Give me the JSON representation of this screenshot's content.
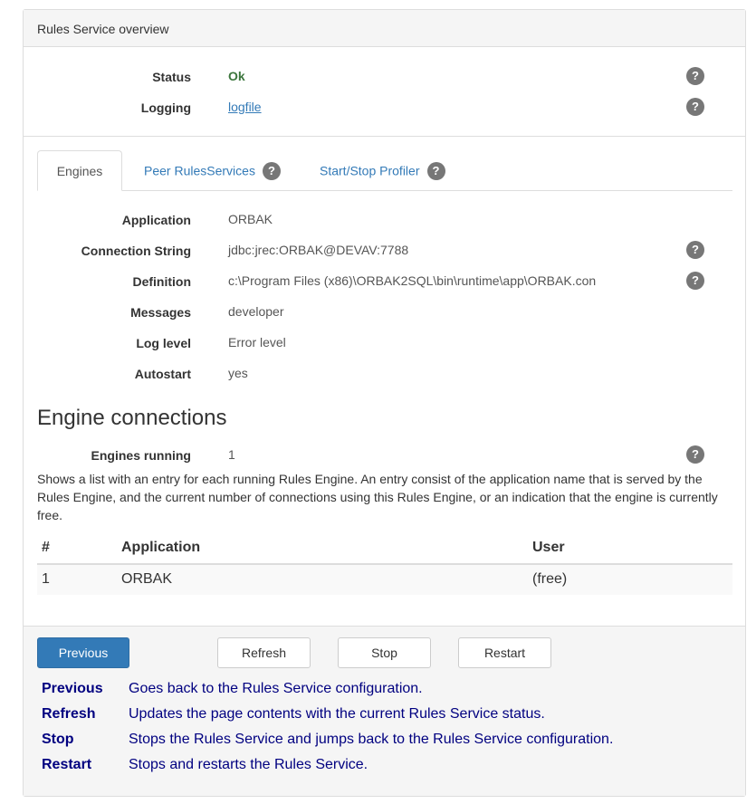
{
  "panel": {
    "title": "Rules Service overview"
  },
  "overview": {
    "status_label": "Status",
    "status_value": "Ok",
    "logging_label": "Logging",
    "logging_value": "logfile"
  },
  "help_icon_text": "?",
  "tabs": [
    {
      "label": "Engines",
      "active": true
    },
    {
      "label": "Peer RulesServices",
      "active": false
    },
    {
      "label": "Start/Stop Profiler",
      "active": false
    }
  ],
  "engine": {
    "application_label": "Application",
    "application_value": "ORBAK",
    "connection_label": "Connection String",
    "connection_value": "jdbc:jrec:ORBAK@DEVAV:7788",
    "definition_label": "Definition",
    "definition_value": "c:\\Program Files (x86)\\ORBAK2SQL\\bin\\runtime\\app\\ORBAK.con",
    "messages_label": "Messages",
    "messages_value": "developer",
    "loglevel_label": "Log level",
    "loglevel_value": "Error level",
    "autostart_label": "Autostart",
    "autostart_value": "yes"
  },
  "connections": {
    "heading": "Engine connections",
    "running_label": "Engines running",
    "running_value": "1",
    "description": "Shows a list with an entry for each running Rules Engine. An entry consist of the application name that is served by the Rules Engine, and the current number of connections using this Rules Engine, or an indication that the engine is currently free.",
    "table": {
      "headers": [
        "#",
        "Application",
        "User"
      ],
      "rows": [
        [
          "1",
          "ORBAK",
          "(free)"
        ]
      ]
    }
  },
  "buttons": {
    "previous": "Previous",
    "refresh": "Refresh",
    "stop": "Stop",
    "restart": "Restart"
  },
  "help": [
    {
      "term": "Previous",
      "desc": "Goes back to the Rules Service configuration."
    },
    {
      "term": "Refresh",
      "desc": "Updates the page contents with the current Rules Service status."
    },
    {
      "term": "Stop",
      "desc": "Stops the Rules Service and jumps back to the Rules Service configuration."
    },
    {
      "term": "Restart",
      "desc": "Stops and restarts the Rules Service."
    }
  ],
  "colors": {
    "primary": "#337ab7",
    "ok": "#3c763d",
    "help_text": "#000080",
    "help_icon": "#777777"
  }
}
